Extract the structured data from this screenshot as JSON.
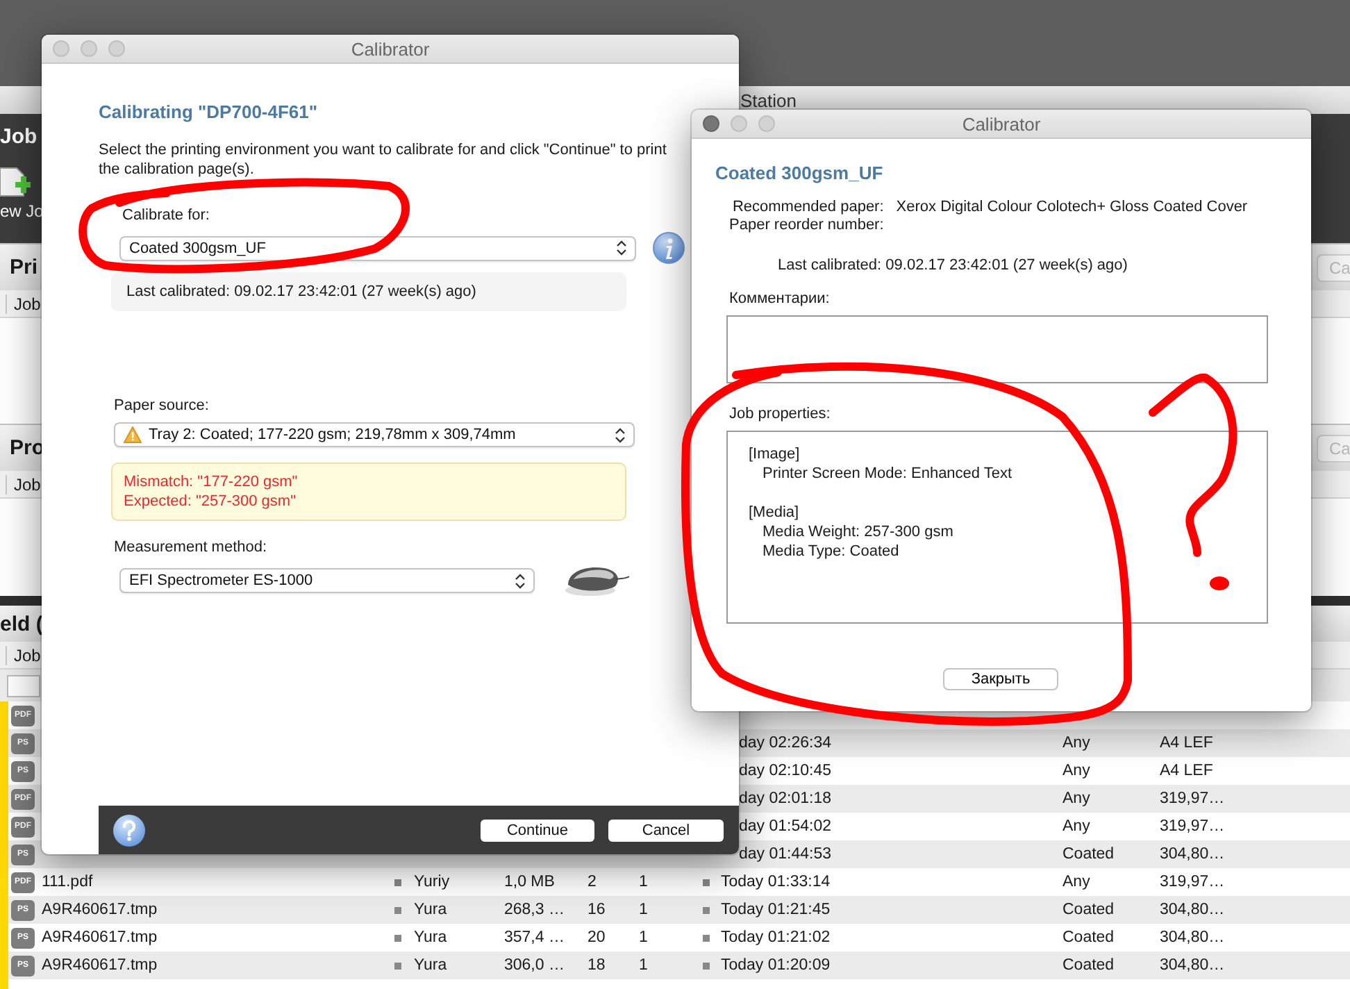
{
  "background_app": {
    "window_title": "Station",
    "toolbar": {
      "title": "Job",
      "new_job_label": "ew Jo"
    },
    "panels": [
      {
        "title": "Pri",
        "column_header": "Job",
        "button": "Ca"
      },
      {
        "title": "Pro",
        "column_header": "Job",
        "button": "Ca"
      }
    ],
    "job_list": {
      "title": "eld (",
      "column_header": "Job",
      "rows": [
        {
          "kind": "icon_only",
          "type": "PDF"
        },
        {
          "kind": "partial",
          "type": "PS",
          "date": "day 02:26:34",
          "media": "Any",
          "paper_size": "A4 LEF"
        },
        {
          "kind": "partial",
          "type": "PS",
          "date": "day 02:10:45",
          "media": "Any",
          "paper_size": "A4 LEF"
        },
        {
          "kind": "partial",
          "type": "PDF",
          "date": "day 02:01:18",
          "media": "Any",
          "paper_size": "319,97…"
        },
        {
          "kind": "partial",
          "type": "PDF",
          "date": "day 01:54:02",
          "media": "Any",
          "paper_size": "319,97…"
        },
        {
          "kind": "partial",
          "type": "PS",
          "date": "day 01:44:53",
          "media": "Coated",
          "paper_size": "304,80…"
        },
        {
          "kind": "full",
          "type": "PDF",
          "name": "111.pdf",
          "owner": "Yuriy",
          "size": "1,0 MB",
          "pages": "2",
          "copies": "1",
          "date": "Today 01:33:14",
          "media": "Any",
          "paper_size": "319,97…"
        },
        {
          "kind": "full",
          "type": "PS",
          "name": "A9R460617.tmp",
          "owner": "Yura",
          "size": "268,3 …",
          "pages": "16",
          "copies": "1",
          "date": "Today 01:21:45",
          "media": "Coated",
          "paper_size": "304,80…"
        },
        {
          "kind": "full",
          "type": "PS",
          "name": "A9R460617.tmp",
          "owner": "Yura",
          "size": "357,4 …",
          "pages": "20",
          "copies": "1",
          "date": "Today 01:21:02",
          "media": "Coated",
          "paper_size": "304,80…"
        },
        {
          "kind": "full",
          "type": "PS",
          "name": "A9R460617.tmp",
          "owner": "Yura",
          "size": "306,0 …",
          "pages": "18",
          "copies": "1",
          "date": "Today 01:20:09",
          "media": "Coated",
          "paper_size": "304,80…"
        }
      ]
    }
  },
  "calibrate_dialog": {
    "title": "Calibrator",
    "heading": "Calibrating \"DP700-4F61\"",
    "instructions": "Select the printing environment you want to calibrate for and click \"Continue\" to print the calibration page(s).",
    "calibrate_for": {
      "label": "Calibrate for:",
      "value": "Coated 300gsm_UF"
    },
    "last_calibrated": "Last calibrated: 09.02.17 23:42:01 (27 week(s) ago)",
    "paper_source": {
      "label": "Paper source:",
      "value": "Tray 2: Coated; 177-220 gsm; 219,78mm x 309,74mm",
      "warning": true
    },
    "mismatch_messages": [
      "Mismatch: \"177-220 gsm\"",
      "Expected: \"257-300 gsm\""
    ],
    "measurement_method": {
      "label": "Measurement method:",
      "value": "EFI Spectrometer ES-1000"
    },
    "buttons": [
      "Continue",
      "Cancel"
    ]
  },
  "details_dialog": {
    "title": "Calibrator",
    "heading": "Coated 300gsm_UF",
    "info": [
      {
        "label": "Recommended paper:",
        "value": "Xerox Digital Colour Colotech+ Gloss Coated Cover"
      },
      {
        "label": "Paper reorder number:"
      }
    ],
    "last_calibrated": "Last calibrated: 09.02.17 23:42:01 (27 week(s) ago)",
    "comments": {
      "label": "Комментарии:"
    },
    "job_properties": {
      "label": "Job properties:",
      "sections": [
        {
          "name": "[Image]",
          "entries": [
            "Printer Screen Mode: Enhanced Text"
          ]
        },
        {
          "name": "[Media]",
          "entries": [
            "Media Weight: 257-300 gsm",
            "Media Type: Coated"
          ]
        }
      ]
    },
    "close_button": "Закрыть"
  }
}
